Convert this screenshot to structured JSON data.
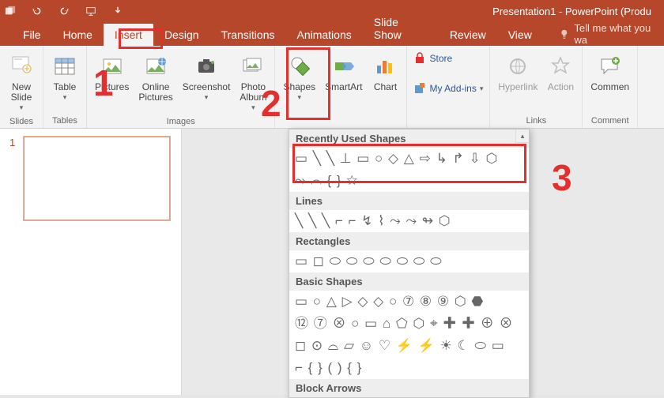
{
  "title": "Presentation1 - PowerPoint (Produ",
  "tabs": [
    "File",
    "Home",
    "Insert",
    "Design",
    "Transitions",
    "Animations",
    "Slide Show",
    "Review",
    "View"
  ],
  "activeTab": 2,
  "tellMe": "Tell me what you wa",
  "ribbon": {
    "slides": {
      "newSlide": "New\nSlide",
      "label": "Slides"
    },
    "tables": {
      "table": "Table",
      "label": "Tables"
    },
    "images": {
      "pictures": "Pictures",
      "online": "Online\nPictures",
      "screenshot": "Screenshot",
      "album": "Photo\nAlbum",
      "label": "Images"
    },
    "illus": {
      "shapes": "Shapes",
      "smartart": "SmartArt",
      "chart": "Chart"
    },
    "addins": {
      "store": "Store",
      "my": "My Add-ins"
    },
    "links": {
      "hyperlink": "Hyperlink",
      "action": "Action",
      "label": "Links"
    },
    "comments": {
      "new": "Commen",
      "label": "Comment"
    }
  },
  "thumb": {
    "num": "1"
  },
  "shapesMenu": {
    "recent": "Recently Used Shapes",
    "lines": "Lines",
    "rects": "Rectangles",
    "basic": "Basic Shapes",
    "block": "Block Arrows"
  },
  "annotations": {
    "n1": "1",
    "n2": "2",
    "n3": "3"
  }
}
